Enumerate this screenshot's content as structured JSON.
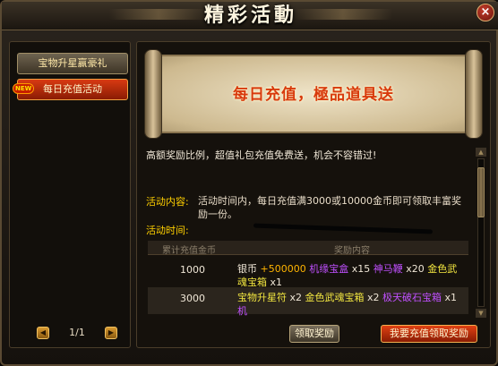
{
  "window": {
    "title": "精彩活動",
    "close_label": "×"
  },
  "sidebar": {
    "items": [
      {
        "label": "宝物升星赢豪礼"
      },
      {
        "label": "每日充值活动",
        "tag": "NEW"
      }
    ],
    "pager": {
      "prev": "◀",
      "page": "1/1",
      "next": "▶"
    }
  },
  "banner": {
    "text": "每日充值，極品道具送"
  },
  "details": {
    "description": "高额奖励比例，超值礼包充值免费送，机会不容错过!",
    "content_label": "活动内容:",
    "content_text": "活动时间内，每日充值满3000或10000金币即可领取丰富奖励一份。",
    "time_label": "活动时间:"
  },
  "reward_table": {
    "headers": [
      "累计充值金币",
      "奖励内容"
    ],
    "rows": [
      {
        "amount": "1000",
        "reward_parts": [
          {
            "text": "银币 ",
            "color": "white"
          },
          {
            "text": "+500000 ",
            "color": "gold"
          },
          {
            "text": "机缘宝盒 ",
            "color": "purple"
          },
          {
            "text": "x15 ",
            "color": "white"
          },
          {
            "text": "神马鞭 ",
            "color": "purple"
          },
          {
            "text": "x20 ",
            "color": "white"
          },
          {
            "text": "金色武魂宝箱 ",
            "color": "yellow"
          },
          {
            "text": "x1",
            "color": "white"
          }
        ]
      },
      {
        "amount": "3000",
        "reward_parts": [
          {
            "text": "宝物升星符 ",
            "color": "yellow"
          },
          {
            "text": "x2 ",
            "color": "white"
          },
          {
            "text": "金色武魂宝箱 ",
            "color": "yellow"
          },
          {
            "text": "x2 ",
            "color": "white"
          },
          {
            "text": "极天破石宝箱 ",
            "color": "purple"
          },
          {
            "text": "x1 ",
            "color": "white"
          },
          {
            "text": "机",
            "color": "purple"
          }
        ]
      }
    ]
  },
  "buttons": {
    "claim": "领取奖励",
    "recharge": "我要充值领取奖励"
  },
  "colors": {
    "white": "#efe6d6",
    "gold": "#ffb400",
    "purple": "#c050ff",
    "yellow": "#f2e640",
    "accent_red": "#d83a0c"
  }
}
